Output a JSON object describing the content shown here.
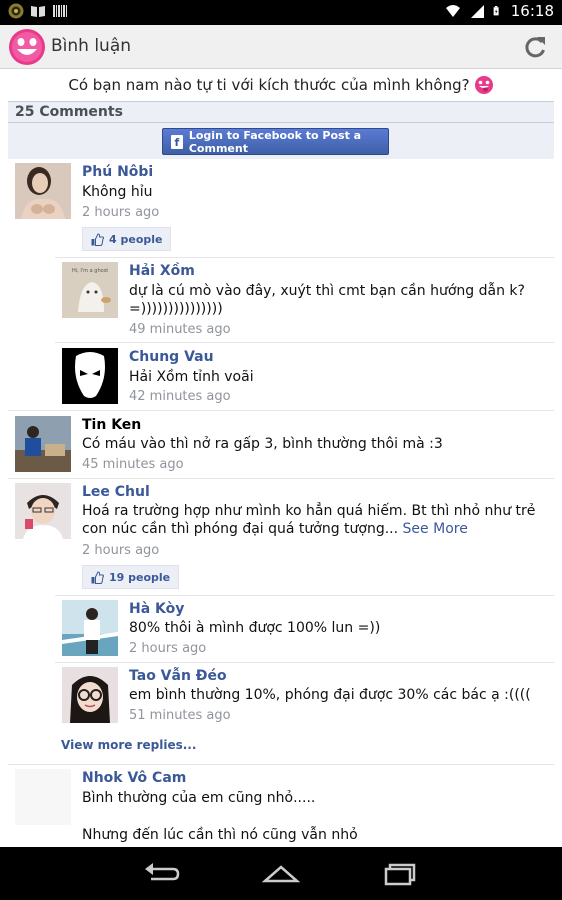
{
  "status_bar": {
    "time": "16:18",
    "battery_level": "",
    "icons": [
      "app-coin-icon",
      "book-icon",
      "barcode-icon",
      "wifi-icon",
      "signal-icon",
      "battery-icon"
    ]
  },
  "action_bar": {
    "title": "Bình luận",
    "logo": "smiley-face-logo",
    "refresh_icon": "refresh-icon"
  },
  "question": {
    "text": "Có bạn nam nào tự ti với kích thước của mình không?",
    "emoji": "tongue-out-emoji"
  },
  "comments_header": {
    "count_label": "25 Comments",
    "login_button": "Login to Facebook to Post a Comment"
  },
  "comments": [
    {
      "name": "Phú Nôbi",
      "text": "Không hỉu",
      "time": "2 hours ago",
      "likes": "4 people"
    },
    {
      "name": "Hải Xồm",
      "text_line1": "dự là cú mò vào đây, xuýt thì cmt bạn cần hướng dẫn k?",
      "text_line2": "=)))))))))))))))",
      "time": "49 minutes ago",
      "avatar_text": "Hi, I'm a ghost"
    },
    {
      "name": "Chung Vau",
      "text": "Hải Xồm tỉnh voãi",
      "time": "42 minutes ago"
    },
    {
      "name": "Tin Ken",
      "text": "Có máu vào thì nở ra gấp 3, bình thường thôi mà :3",
      "time": "45 minutes ago"
    },
    {
      "name": "Lee Chul",
      "text_line1": "Hoá ra trường hợp như mình ko hẳn quá hiếm. Bt thì nhỏ như trẻ",
      "text_line2": "con núc cần thì phóng đại quá tưởng tượng...",
      "see_more": "See More",
      "time": "2 hours ago",
      "likes": "19 people"
    },
    {
      "name": "Hà Kòy",
      "text": "80% thôi à mình được 100% lun =))",
      "time": "2 hours ago"
    },
    {
      "name": "Tao Vẫn Đéo",
      "text": "em bình thường 10%, phóng đại được 30% các bác ạ :((((",
      "time": "51 minutes ago"
    },
    {
      "name": "Nhok Vô Cam",
      "text_line1": "Bình thường của em cũng nhỏ.....",
      "text_line2": "Nhưng đến lúc cần thì nó cũng vẫn nhỏ"
    }
  ],
  "view_more_replies": "View more replies...",
  "nav_bar": {
    "icons": [
      "back-icon",
      "home-icon",
      "recent-apps-icon"
    ]
  },
  "colors": {
    "facebook_blue": "#3b5998",
    "login_button": "#4267b2",
    "header_bg": "#eceff5",
    "time_gray": "#90949c"
  }
}
